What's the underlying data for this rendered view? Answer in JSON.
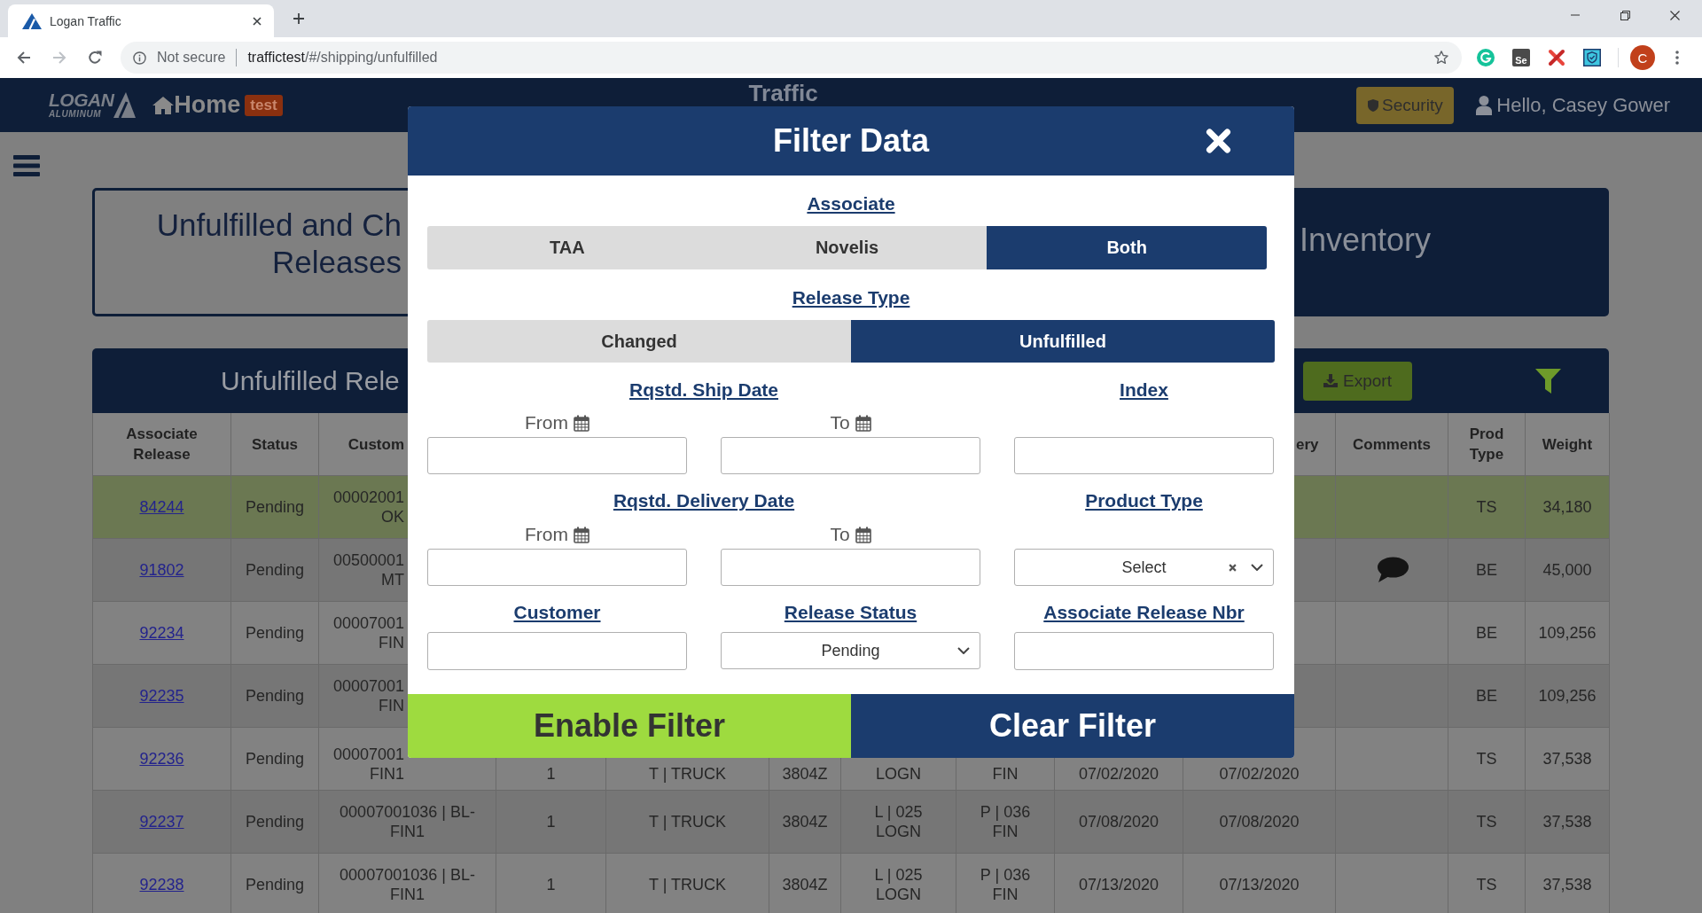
{
  "browser": {
    "tab": {
      "title": "Logan Traffic"
    },
    "back": {
      "disabled": false
    },
    "forward": {
      "disabled": true
    },
    "address": {
      "security_label": "Not secure",
      "host": "traffictest",
      "path": "/#/shipping/unfulfilled"
    },
    "extensions": [
      {
        "kind": "ring"
      },
      {
        "kind": "tile",
        "text": "Se"
      },
      {
        "kind": "cross"
      },
      {
        "kind": "shield"
      }
    ],
    "profile_initial": "C"
  },
  "app_header": {
    "logo": {
      "name": "LOGAN",
      "subtitle": "ALUMINUM"
    },
    "home_label": "Home",
    "environment_badge": "test",
    "title": "Traffic",
    "security_button": "Security",
    "greeting": "Hello, Casey Gower"
  },
  "page": {
    "title_lines": [
      "Unfulfilled and Ch",
      "Releases"
    ],
    "inventory_title": "Inventory"
  },
  "table": {
    "title": "Unfulfilled Rele",
    "export_button": "Export",
    "columns": {
      "associate_release": "Associate Release",
      "status": "Status",
      "column_3": "Custom",
      "column_10": "ery",
      "comments": "Comments",
      "prod_type": "Prod Type",
      "weight": "Weight"
    },
    "rows": [
      {
        "kind": "covered",
        "highlighted": true,
        "comment": false,
        "associate_release": "84244",
        "status": "Pending",
        "column_3": [
          "00002001",
          "OK"
        ],
        "prod_type": "TS",
        "weight": "34,180"
      },
      {
        "kind": "covered",
        "highlighted": false,
        "comment": true,
        "associate_release": "91802",
        "status": "Pending",
        "column_3": [
          "00500001",
          "MT"
        ],
        "prod_type": "BE",
        "weight": "45,000"
      },
      {
        "kind": "covered",
        "highlighted": false,
        "comment": false,
        "associate_release": "92234",
        "status": "Pending",
        "column_3": [
          "00007001",
          "FIN"
        ],
        "prod_type": "BE",
        "weight": "109,256"
      },
      {
        "kind": "covered",
        "highlighted": false,
        "comment": false,
        "associate_release": "92235",
        "status": "Pending",
        "column_3": [
          "00007001",
          "FIN"
        ],
        "prod_type": "BE",
        "weight": "109,256"
      },
      {
        "kind": "edge",
        "highlighted": false,
        "comment": false,
        "associate_release": "92236",
        "status": "Pending",
        "column_3": [
          "00007001",
          "FIN1"
        ],
        "column_4": "1",
        "column_5": "T | TRUCK",
        "column_6": "3804Z",
        "column_7": "LOGN",
        "column_8": "FIN",
        "column_9": "07/02/2020",
        "column_10": "07/02/2020",
        "prod_type": "TS",
        "weight": "37,538"
      },
      {
        "kind": "clear",
        "highlighted": false,
        "comment": false,
        "associate_release": "92237",
        "status": "Pending",
        "column_3": [
          "00007001036 | BL-",
          "FIN1"
        ],
        "column_4": "1",
        "column_5": "T | TRUCK",
        "column_6": "3804Z",
        "column_7": [
          "L | 025",
          "LOGN"
        ],
        "column_8": [
          "P | 036",
          "FIN"
        ],
        "column_9": "07/08/2020",
        "column_10": "07/08/2020",
        "prod_type": "TS",
        "weight": "37,538"
      },
      {
        "kind": "clear",
        "highlighted": false,
        "comment": false,
        "associate_release": "92238",
        "status": "Pending",
        "column_3": [
          "00007001036 | BL-",
          "FIN1"
        ],
        "column_4": "1",
        "column_5": "T | TRUCK",
        "column_6": "3804Z",
        "column_7": [
          "L | 025",
          "LOGN"
        ],
        "column_8": [
          "P | 036",
          "FIN"
        ],
        "column_9": "07/13/2020",
        "column_10": "07/13/2020",
        "prod_type": "TS",
        "weight": "37,538"
      }
    ]
  },
  "filter_dialog": {
    "title": "Filter Data",
    "associate": {
      "label": "Associate",
      "options": [
        {
          "label": "TAA",
          "selected": false
        },
        {
          "label": "Novelis",
          "selected": false
        },
        {
          "label": "Both",
          "selected": true
        }
      ]
    },
    "release_type": {
      "label": "Release Type",
      "options": [
        {
          "label": "Changed",
          "selected": false
        },
        {
          "label": "Unfulfilled",
          "selected": true
        }
      ]
    },
    "ship_date": {
      "label": "Rqstd. Ship Date",
      "from": "From",
      "to": "To"
    },
    "index": {
      "label": "Index"
    },
    "delivery_date": {
      "label": "Rqstd. Delivery Date",
      "from": "From",
      "to": "To"
    },
    "product_type": {
      "label": "Product Type",
      "placeholder": "Select"
    },
    "customer": {
      "label": "Customer"
    },
    "release_status": {
      "label": "Release Status",
      "value": "Pending"
    },
    "associate_release_nbr": {
      "label": "Associate Release Nbr"
    },
    "buttons": [
      {
        "label": "Enable Filter",
        "kind": "primary"
      },
      {
        "label": "Clear Filter",
        "kind": "secondary"
      }
    ]
  }
}
